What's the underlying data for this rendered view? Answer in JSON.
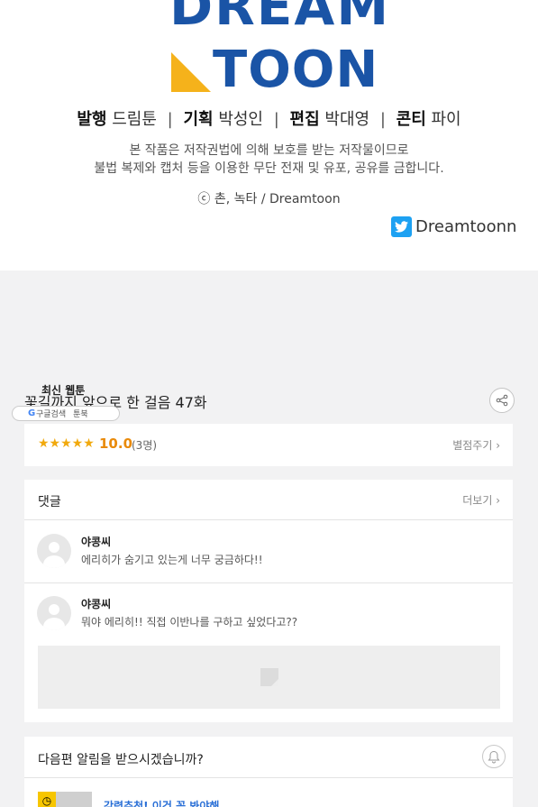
{
  "colophon": {
    "logo_line1": "DREAM",
    "logo_line2": "TOON",
    "credits": [
      {
        "role": "발행",
        "name": "드림툰"
      },
      {
        "role": "기획",
        "name": "박성인"
      },
      {
        "role": "편집",
        "name": "박대영"
      },
      {
        "role": "콘티",
        "name": "파이"
      }
    ],
    "separator": "|",
    "notice_line1": "본 작품은 저작권법에 의해 보호를 받는 저작물이므로",
    "notice_line2": "불법 복제와 캡처 등을 이용한 무단 전재 및 유포, 공유를 금합니다.",
    "copyright": "ⓒ 촌, 녹타 / Dreamtoon",
    "twitter_handle": "Dreamtoonn",
    "twitter_icon": "twitter-bird-icon"
  },
  "episode": {
    "title": "꽃길까지 앞으로 한 걸음 47화",
    "share_icon": "share-icon"
  },
  "floating": {
    "label": "최신 웹툰",
    "badge_g": "G",
    "badge_item1": "구글검색",
    "badge_item2": "툰북"
  },
  "rating": {
    "stars": "★★★★★",
    "score": "10.0",
    "count": "(3명)",
    "rate_link": "별점주기 ›",
    "star_value": 5
  },
  "comments": {
    "header": "댓글",
    "more": "더보기 ›",
    "items": [
      {
        "user": "야콩씨",
        "text": "에리히가 숨기고 있는게 너무 궁금하다!!"
      },
      {
        "user": "야콩씨",
        "text": "뭐야 에리히!! 직접 이반나를 구하고 싶었다고??"
      }
    ]
  },
  "notify": {
    "question": "다음편 알림을 받으시겠습니까?",
    "bell_icon": "bell-icon",
    "promo_text": "강력추천! 이건 꼭 봐야해"
  },
  "colors": {
    "brand_blue": "#1a54a6",
    "brand_yellow": "#f5b21b",
    "star": "#f1a90d",
    "score": "#e98a0b",
    "twitter": "#1da1f2",
    "link_blue": "#2a6fd6"
  }
}
